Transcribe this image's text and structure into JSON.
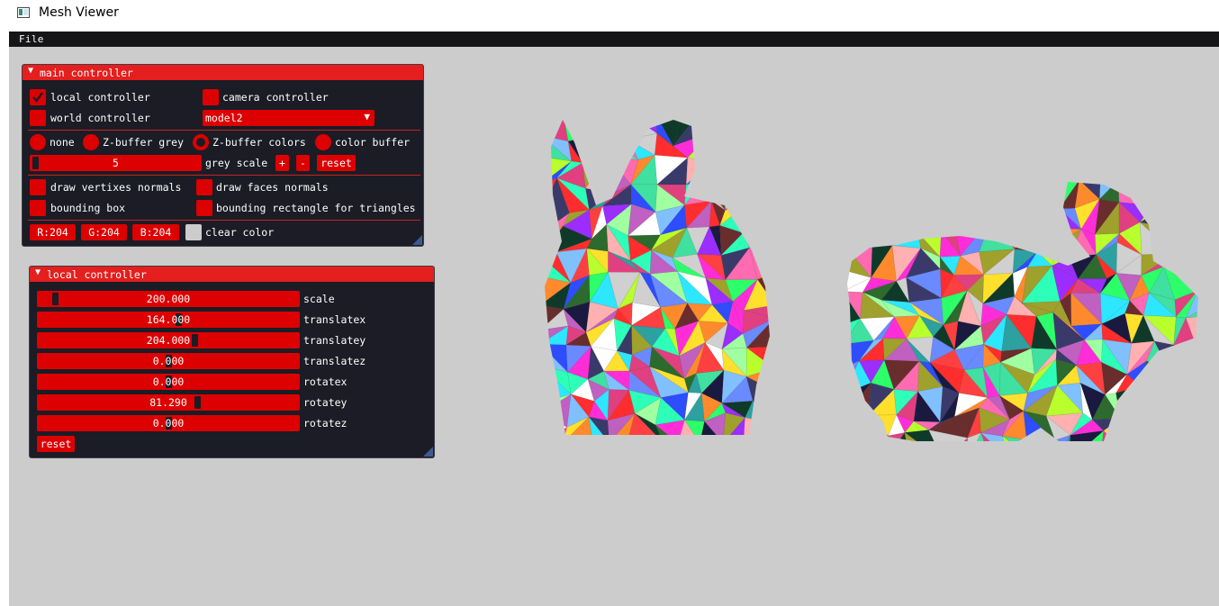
{
  "window": {
    "title": "Mesh Viewer",
    "icon": "window-app-icon"
  },
  "menu": {
    "file": "File"
  },
  "main_controller": {
    "title": "main controller",
    "local_controller": {
      "label": "local controller",
      "checked": true
    },
    "camera_controller": {
      "label": "camera controller",
      "checked": false
    },
    "world_controller": {
      "label": "world controller",
      "checked": false
    },
    "model_select": "model2",
    "render_modes": [
      {
        "label": "none",
        "selected": false
      },
      {
        "label": "Z-buffer grey",
        "selected": false
      },
      {
        "label": "Z-buffer colors",
        "selected": true
      },
      {
        "label": "color buffer",
        "selected": false
      }
    ],
    "grey_scale": {
      "value": "5",
      "label": "grey scale",
      "plus": "+",
      "minus": "-",
      "reset": "reset"
    },
    "draw_vertex_normals": "draw vertixes normals",
    "draw_face_normals": "draw faces normals",
    "bounding_box": "bounding box",
    "bounding_rect": "bounding rectangle for triangles",
    "clear_color": {
      "r": "R:204",
      "g": "G:204",
      "b": "B:204",
      "label": "clear color",
      "swatch": "#cccccc"
    }
  },
  "local_controller": {
    "title": "local controller",
    "sliders": [
      {
        "value": "200.000",
        "label": "scale"
      },
      {
        "value": "164.000",
        "label": "translatex"
      },
      {
        "value": "204.000",
        "label": "translatey"
      },
      {
        "value": "0.000",
        "label": "translatez"
      },
      {
        "value": "0.000",
        "label": "rotatex"
      },
      {
        "value": "81.290",
        "label": "rotatey"
      },
      {
        "value": "0.000",
        "label": "rotatez"
      }
    ],
    "reset": "reset"
  },
  "colors": {
    "accent": "#dd0000",
    "header": "#e51e1e",
    "panel_bg": "#1b1c25",
    "viewport_bg": "#cccccc"
  }
}
